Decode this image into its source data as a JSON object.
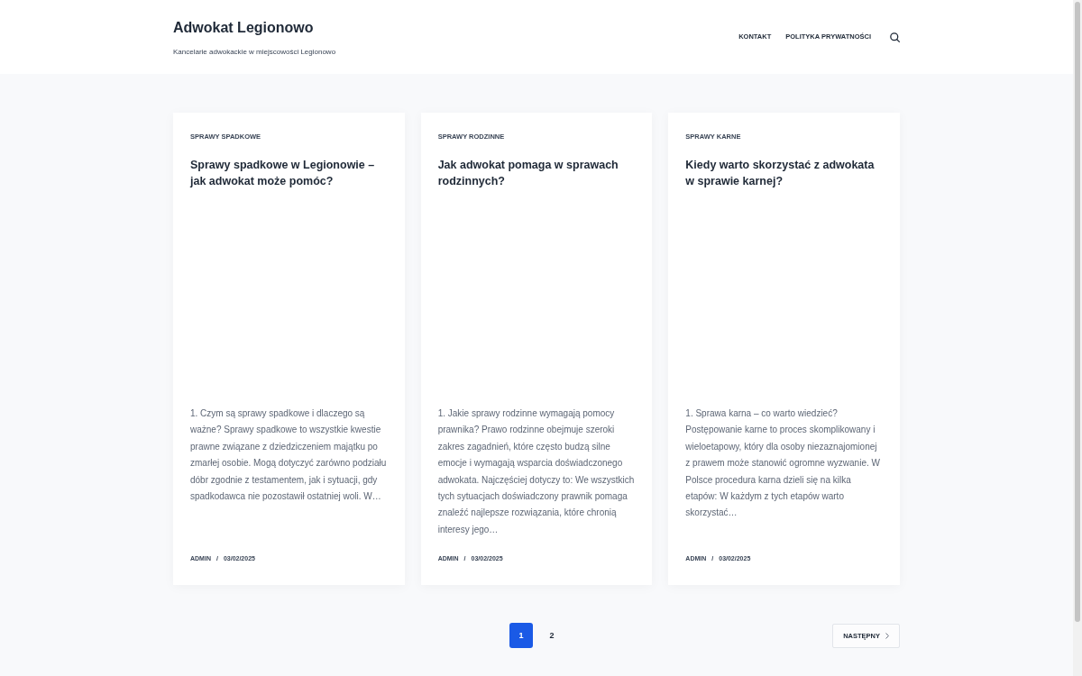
{
  "site": {
    "title": "Adwokat Legionowo",
    "tagline": "Kancelarie adwokackie w miejscowości Legionowo"
  },
  "nav": {
    "items": [
      {
        "label": "KONTAKT"
      },
      {
        "label": "POLITYKA PRYWATNOŚCI"
      }
    ]
  },
  "posts": [
    {
      "category": "SPRAWY SPADKOWE",
      "title": "Sprawy spadkowe w Legionowie – jak adwokat może pomóc?",
      "excerpt": "1. Czym są sprawy spadkowe i dlaczego są ważne? Sprawy spadkowe to wszystkie kwestie prawne związane z dziedziczeniem majątku po zmarłej osobie. Mogą dotyczyć zarówno podziału dóbr zgodnie z testamentem, jak i sytuacji, gdy spadkodawca nie pozostawił ostatniej woli. W…",
      "author": "ADMIN",
      "separator": "/",
      "date": "03/02/2025"
    },
    {
      "category": "SPRAWY RODZINNE",
      "title": "Jak adwokat pomaga w sprawach rodzinnych?",
      "excerpt": "1. Jakie sprawy rodzinne wymagają pomocy prawnika? Prawo rodzinne obejmuje szeroki zakres zagadnień, które często budzą silne emocje i wymagają wsparcia doświadczonego adwokata. Najczęściej dotyczy to: We wszystkich tych sytuacjach doświadczony prawnik pomaga znaleźć najlepsze rozwiązania, które chronią interesy jego…",
      "author": "ADMIN",
      "separator": "/",
      "date": "03/02/2025"
    },
    {
      "category": "SPRAWY KARNE",
      "title": "Kiedy warto skorzystać z adwokata w sprawie karnej?",
      "excerpt": "1. Sprawa karna – co warto wiedzieć? Postępowanie karne to proces skomplikowany i wieloetapowy, który dla osoby niezaznajomionej z prawem może stanowić ogromne wyzwanie. W Polsce procedura karna dzieli się na kilka etapów: W każdym z tych etapów warto skorzystać…",
      "author": "ADMIN",
      "separator": "/",
      "date": "03/02/2025"
    }
  ],
  "pagination": {
    "pages": [
      {
        "label": "1",
        "selected": true
      },
      {
        "label": "2",
        "selected": false
      }
    ],
    "next": {
      "label": "NASTĘPNY"
    }
  }
}
